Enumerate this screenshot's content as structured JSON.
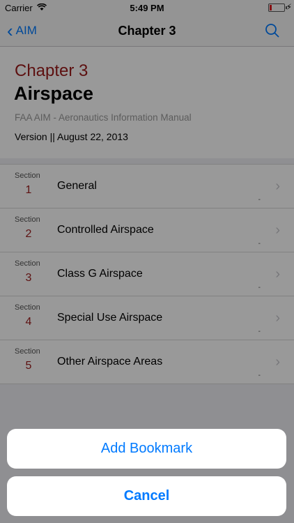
{
  "status_bar": {
    "carrier": "Carrier",
    "time": "5:49 PM"
  },
  "nav": {
    "back_label": "AIM",
    "title": "Chapter 3"
  },
  "header": {
    "chapter_label": "Chapter 3",
    "chapter_title": "Airspace",
    "subtitle": "FAA AIM - Aeronautics Information Manual",
    "version": "Version || August 22, 2013"
  },
  "sections": [
    {
      "label": "Section",
      "number": "1",
      "name": "General",
      "dash": "-"
    },
    {
      "label": "Section",
      "number": "2",
      "name": "Controlled Airspace",
      "dash": "-"
    },
    {
      "label": "Section",
      "number": "3",
      "name": "Class G Airspace",
      "dash": "-"
    },
    {
      "label": "Section",
      "number": "4",
      "name": "Special Use Airspace",
      "dash": "-"
    },
    {
      "label": "Section",
      "number": "5",
      "name": "Other Airspace Areas",
      "dash": "-"
    }
  ],
  "action_sheet": {
    "add_bookmark": "Add Bookmark",
    "cancel": "Cancel"
  },
  "colors": {
    "accent": "#007aff",
    "chapter_red": "#9b1c1c"
  },
  "icons": [
    "wifi-icon",
    "battery-icon",
    "back-chevron-icon",
    "search-icon",
    "chevron-right-icon"
  ]
}
